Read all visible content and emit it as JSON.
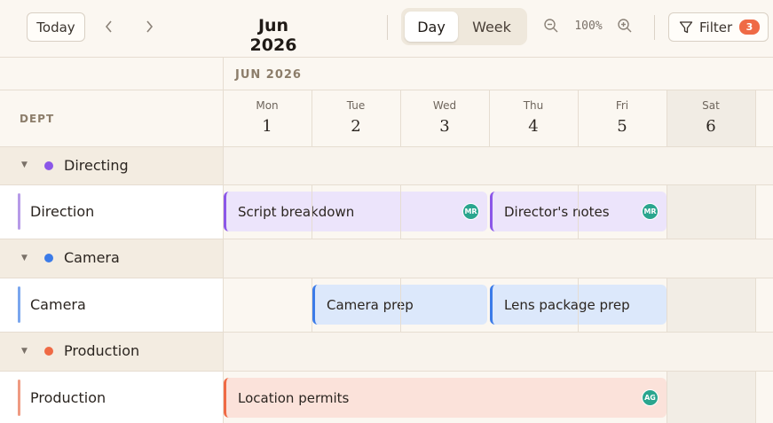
{
  "toolbar": {
    "today_label": "Today",
    "prev_icon": "chevron-left-icon",
    "next_icon": "chevron-right-icon",
    "month_title": "Jun 2026",
    "view_options": [
      "Day",
      "Week"
    ],
    "active_view": "Day",
    "zoom_value": "100%",
    "filter_label": "Filter",
    "filter_count": "3"
  },
  "grid": {
    "month_label": "JUN 2026",
    "dept_header": "DEPT",
    "days": [
      {
        "name": "Mon",
        "num": "1"
      },
      {
        "name": "Tue",
        "num": "2"
      },
      {
        "name": "Wed",
        "num": "3"
      },
      {
        "name": "Thu",
        "num": "4"
      },
      {
        "name": "Fri",
        "num": "5"
      },
      {
        "name": "Sat",
        "num": "6"
      }
    ]
  },
  "groups": [
    {
      "label": "Directing",
      "color": "#8b57e8",
      "row_label": "Direction",
      "row_color": "#b79be8"
    },
    {
      "label": "Camera",
      "color": "#3b7be8",
      "row_label": "Camera",
      "row_color": "#7aa6ee"
    },
    {
      "label": "Production",
      "color": "#ef6a45",
      "row_label": "Production",
      "row_color": "#ef9b82"
    }
  ],
  "events": [
    {
      "label": "Script breakdown",
      "avatar": "MR",
      "bg": "#ece4fb",
      "border": "#8b57e8"
    },
    {
      "label": "Director's notes",
      "avatar": "MR",
      "bg": "#ece4fb",
      "border": "#8b57e8"
    },
    {
      "label": "Camera prep",
      "bg": "#dce8fb",
      "border": "#3b7be8"
    },
    {
      "label": "Lens package prep",
      "bg": "#dce8fb",
      "border": "#3b7be8"
    },
    {
      "label": "Location permits",
      "avatar": "AG",
      "bg": "#fbe2da",
      "border": "#ef6a45"
    }
  ]
}
